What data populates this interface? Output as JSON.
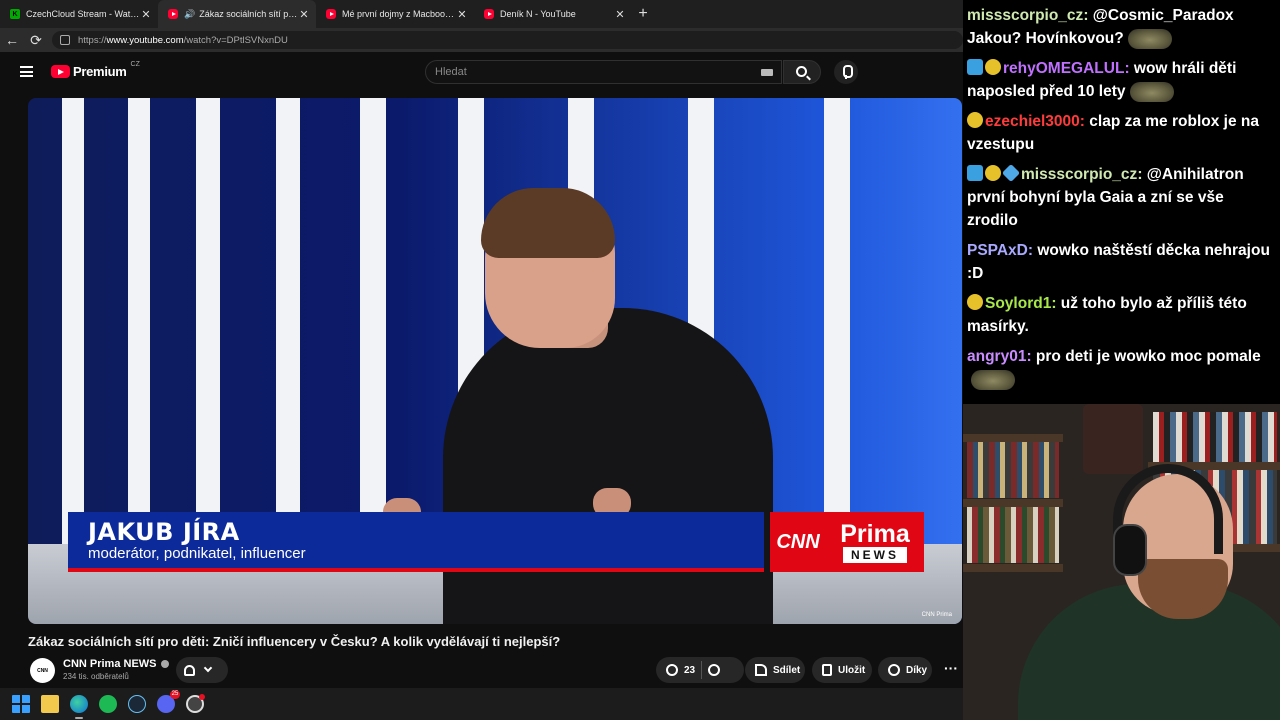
{
  "browser": {
    "tabs": [
      {
        "title": "CzechCloud Stream - Watch Live o",
        "icon": "kick-icon",
        "active": false
      },
      {
        "title": "Zákaz sociálních sítí pro děti:",
        "icon": "youtube-icon",
        "active": true,
        "audio": true
      },
      {
        "title": "Mé první dojmy z Macbook Neo.",
        "icon": "youtube-icon",
        "active": false
      },
      {
        "title": "Deník N - YouTube",
        "icon": "youtube-icon",
        "active": false
      }
    ],
    "url_prefix": "https://",
    "url_host": "www.youtube.com",
    "url_path": "/watch?v=DPtlSVNxnDU"
  },
  "youtube": {
    "logo_text": "Premium",
    "logo_country": "CZ",
    "search_placeholder": "Hledat"
  },
  "video": {
    "lower_third_name": "JAKUB JÍRA",
    "lower_third_role": "moderátor, podnikatel, influencer",
    "brand_left": "CNN",
    "brand_right_top": "Prima",
    "brand_right_bottom": "NEWS",
    "watermark": "CNN Prima",
    "title": "Zákaz sociálních sítí pro děti: Zničí influencery v Česku? A kolik vydělávají ti nejlepší?",
    "channel": "CNN Prima NEWS",
    "subscribers": "234 tis. odběratelů",
    "likes": "23",
    "share_label": "Sdílet",
    "save_label": "Uložit",
    "thanks_label": "Díky",
    "more_label": "···"
  },
  "taskbar": {
    "discord_badge": "25"
  },
  "chat": {
    "messages": [
      {
        "user": "missscorpio_cz",
        "color": "#cfe9b0",
        "text": "@Cosmic_Paradox Jakou? Hovínkovou?",
        "emote": true,
        "badges": []
      },
      {
        "user": "rehyOMEGALUL",
        "color": "#c070ff",
        "text": "wow hráli děti naposled před 10 lety",
        "emote": true,
        "badges": [
          "sub",
          "bits"
        ]
      },
      {
        "user": "ezechiel3000",
        "color": "#ff3b3b",
        "text": "clap za me roblox je na vzestupu",
        "emote": false,
        "badges": [
          "bits"
        ]
      },
      {
        "user": "missscorpio_cz",
        "color": "#cfe9b0",
        "text": "@Anihilatron první bohyní byla Gaia a zní se vše zrodilo",
        "emote": false,
        "badges": [
          "sub",
          "bits",
          "cube"
        ]
      },
      {
        "user": "PSPAxD",
        "color": "#a9a9ff",
        "text": "wowko naštěstí děcka nehrajou :D",
        "emote": false,
        "badges": []
      },
      {
        "user": "Soylord1",
        "color": "#a8e84a",
        "text": "už toho bylo až příliš této masírky.",
        "emote": false,
        "badges": [
          "bits"
        ]
      },
      {
        "user": "angry01",
        "color": "#c98cff",
        "text": "pro deti je wowko moc pomale",
        "emote": true,
        "badges": []
      }
    ]
  }
}
